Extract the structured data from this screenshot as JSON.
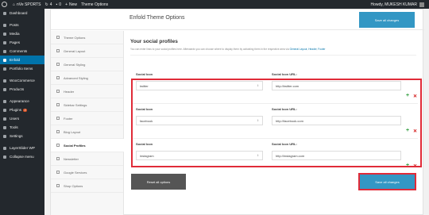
{
  "adminbar": {
    "site_name": "nVe SPORTS",
    "updates_count": "4",
    "comments_count": "0",
    "new_label": "New",
    "theme_options_label": "Theme Options",
    "greeting": "Howdy, MUKESH KUMAR"
  },
  "sidebar": {
    "items": [
      {
        "label": "Dashboard",
        "icon": "dashboard-icon"
      },
      {
        "label": "Posts",
        "icon": "pin-icon"
      },
      {
        "label": "Media",
        "icon": "media-icon"
      },
      {
        "label": "Pages",
        "icon": "page-icon"
      },
      {
        "label": "Comments",
        "icon": "comment-icon"
      },
      {
        "label": "Enfold",
        "icon": "enfold-icon"
      },
      {
        "label": "Portfolio Items",
        "icon": "portfolio-icon"
      },
      {
        "label": "WooCommerce",
        "icon": "woocommerce-icon"
      },
      {
        "label": "Products",
        "icon": "products-icon"
      },
      {
        "label": "Appearance",
        "icon": "brush-icon"
      },
      {
        "label": "Plugins",
        "icon": "plugin-icon",
        "badge": "2"
      },
      {
        "label": "Users",
        "icon": "users-icon"
      },
      {
        "label": "Tools",
        "icon": "wrench-icon"
      },
      {
        "label": "Settings",
        "icon": "settings-icon"
      },
      {
        "label": "LayerSlider WP",
        "icon": "layerslider-icon"
      },
      {
        "label": "Collapse menu",
        "icon": "collapse-icon"
      }
    ]
  },
  "panel": {
    "title": "Enfold Theme Options",
    "save_label": "Save all changes",
    "reset_label": "Reset all options"
  },
  "options_nav": {
    "items": [
      {
        "label": "Theme Options"
      },
      {
        "label": "General Layout"
      },
      {
        "label": "General Styling"
      },
      {
        "label": "Advanced Styling"
      },
      {
        "label": "Header"
      },
      {
        "label": "Sidebar Settings"
      },
      {
        "label": "Footer"
      },
      {
        "label": "Blog Layout"
      },
      {
        "label": "Social Profiles"
      },
      {
        "label": "Newsletter"
      },
      {
        "label": "Google Services"
      },
      {
        "label": "Shop Options"
      }
    ]
  },
  "section": {
    "title": "Your social profiles",
    "description": "You can enter links to your social profiles here. Afterwards you can choose where to display them by activating them in the respective area via",
    "links": [
      "General Layout",
      "Header",
      "Footer"
    ]
  },
  "profiles": {
    "icon_label": "Social Icon",
    "url_label": "Social Icon URL:",
    "rows": [
      {
        "icon": "twitter",
        "url": "http://twitter.com"
      },
      {
        "icon": "facebook",
        "url": "http://facebook.com"
      },
      {
        "icon": "instagram",
        "url": "http://instagram.com"
      }
    ]
  },
  "colors": {
    "accent": "#0073aa",
    "save_button": "#3397c4",
    "highlight": "#e02b38"
  }
}
